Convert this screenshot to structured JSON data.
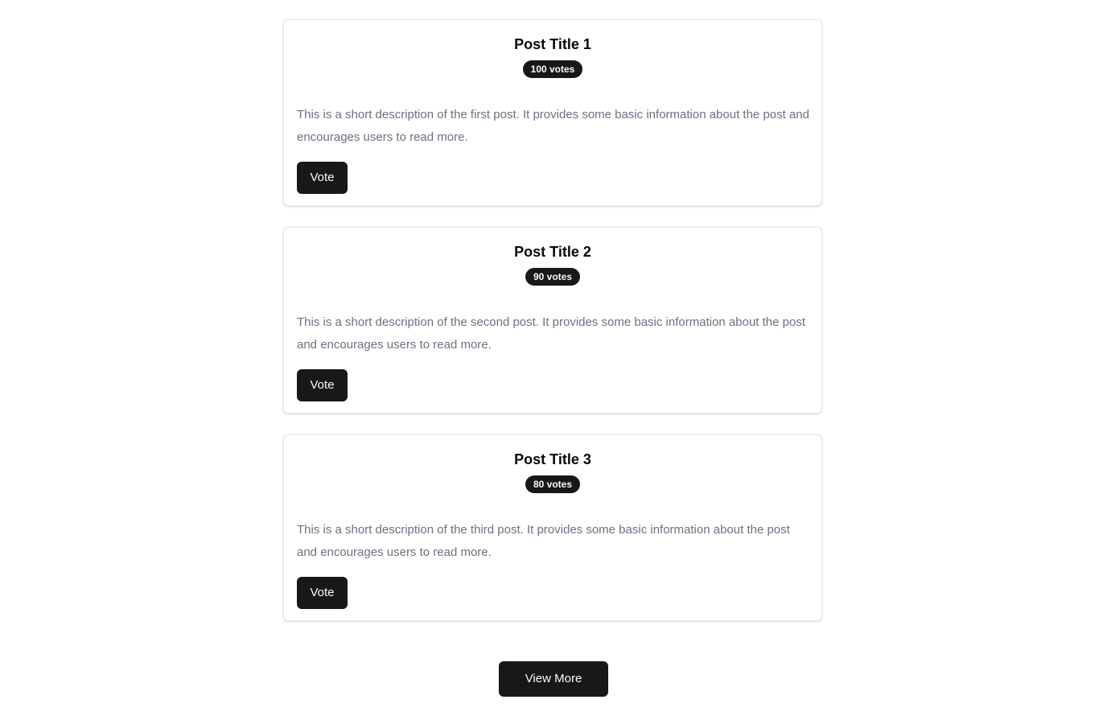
{
  "posts": [
    {
      "title": "Post Title 1",
      "votes": "100 votes",
      "description": "This is a short description of the first post. It provides some basic information about the post and encourages users to read more.",
      "vote_label": "Vote"
    },
    {
      "title": "Post Title 2",
      "votes": "90 votes",
      "description": "This is a short description of the second post. It provides some basic information about the post and encourages users to read more.",
      "vote_label": "Vote"
    },
    {
      "title": "Post Title 3",
      "votes": "80 votes",
      "description": "This is a short description of the third post. It provides some basic information about the post and encourages users to read more.",
      "vote_label": "Vote"
    }
  ],
  "view_more_label": "View More",
  "colors": {
    "button_bg": "#18181b",
    "button_text": "#fafafa",
    "description_text": "#6b7280",
    "card_border": "#e5e7eb"
  }
}
